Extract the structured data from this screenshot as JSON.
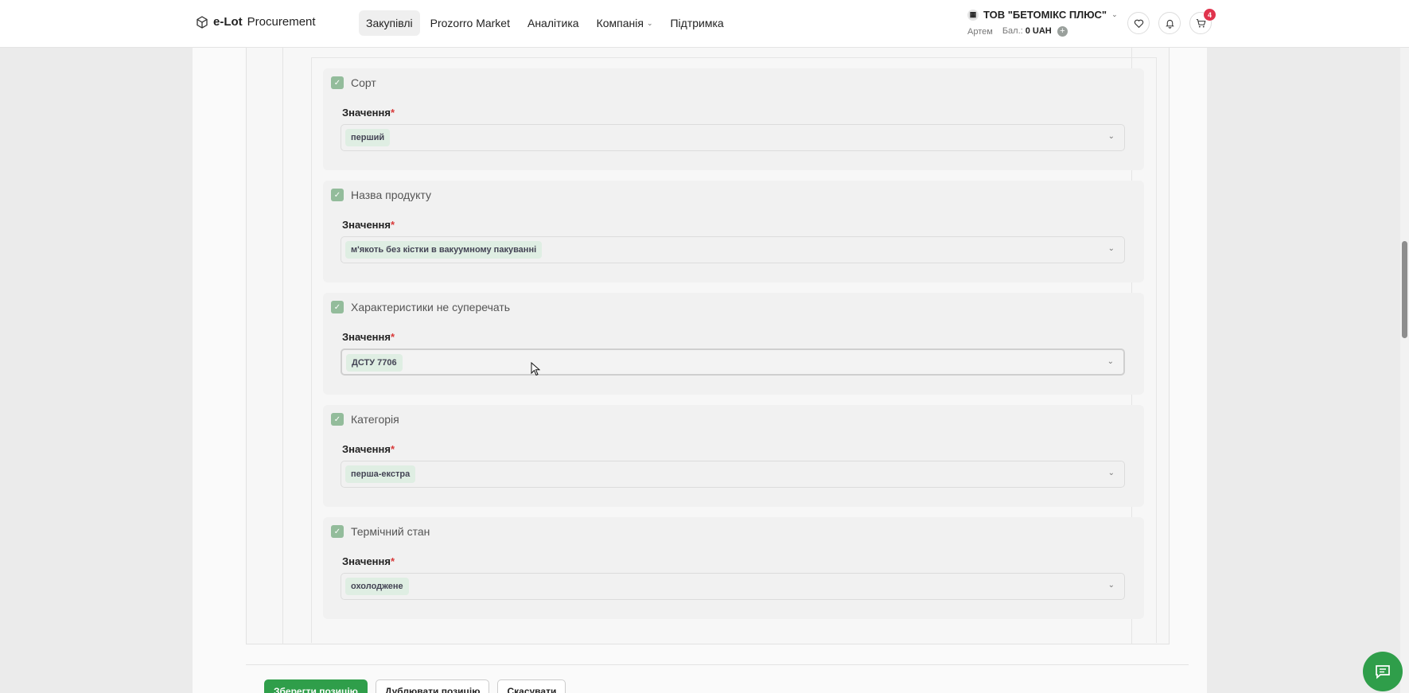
{
  "header": {
    "logo_brand": "e-Lot",
    "logo_suffix": "Procurement",
    "nav": [
      {
        "label": "Закупівлі",
        "active": true
      },
      {
        "label": "Prozorro Market"
      },
      {
        "label": "Аналітика"
      },
      {
        "label": "Компанія",
        "has_dropdown": true
      },
      {
        "label": "Підтримка"
      }
    ],
    "company_name": "ТОВ \"БЕТОМІКС ПЛЮС\"",
    "user_name": "Артем",
    "balance_label": "Бал.:",
    "balance_value": "0 UAH",
    "cart_count": "4"
  },
  "features": [
    {
      "title": "Сорт",
      "label": "Значення",
      "value": "перший"
    },
    {
      "title": "Назва продукту",
      "label": "Значення",
      "value": "м'якоть без кістки в вакуумному пакуванні"
    },
    {
      "title": "Характеристики не суперечать",
      "label": "Значення",
      "value": "ДСТУ 7706",
      "focused": true
    },
    {
      "title": "Категорія",
      "label": "Значення",
      "value": "перша-екстра"
    },
    {
      "title": "Термічний стан",
      "label": "Значення",
      "value": "охолоджене"
    }
  ],
  "required_mark": "*",
  "actions": {
    "save": "Зберегти позицію",
    "duplicate": "Дублювати позицію",
    "cancel": "Скасувати"
  },
  "colors": {
    "accent": "#2f9e4a",
    "badge": "#e0344d",
    "checkbox": "#93bc9b",
    "chip": "#dfeee3"
  }
}
